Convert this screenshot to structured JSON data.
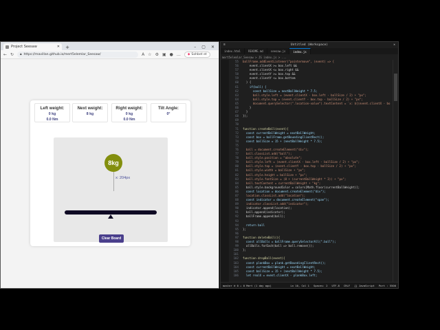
{
  "browser": {
    "tab_title": "Project Seesaw",
    "url": "https://mavillan.github.io/mert5elemlar_Seesaw/",
    "login_label": "Sohbet et"
  },
  "seesaw": {
    "left_weight_label": "Left weight:",
    "left_weight_value": "0 kg",
    "left_torque_value": "0.0 Nm",
    "next_weight_label": "Next weight:",
    "next_weight_value": "8 kg",
    "right_weight_label": "Right weight:",
    "right_weight_value": "0 kg",
    "right_torque_value": "0.0 Nm",
    "tilt_label": "Tilt Angle:",
    "tilt_value": "0°",
    "ball_label": "8kg",
    "ball_color": "#838f0e",
    "location_label": "x: 204px",
    "clear_button": "Clear Board"
  },
  "editor": {
    "title": "Untitled (Workspace)",
    "tabs": [
      "index.html",
      "README.md",
      "seesaw.js",
      "index.js"
    ],
    "active_tab": "index.js",
    "breadcrumb": "mert5elemlar_Seesaw > JS index.js > ...",
    "status_left": "master   ⊗ 0  ⚠ 0   Mert (1 day ago)",
    "status_right": [
      "Ln 10, Col 1",
      "Spaces: 2",
      "UTF-8",
      "CRLF",
      "{} JavaScript",
      "Port : 5500"
    ],
    "lines": [
      {
        "n": "55",
        "t": "ballFrame.addEventListener(\"pointermove\", (event) => {"
      },
      {
        "n": "56",
        "t": "    event.clientX >= box.left &&"
      },
      {
        "n": "57",
        "t": "    event.clientX <= box.right &&"
      },
      {
        "n": "58",
        "t": "    event.clientY >= box.top &&"
      },
      {
        "n": "59",
        "t": "    event.clientY <= box.bottom"
      },
      {
        "n": "60",
        "t": "  ) {"
      },
      {
        "n": "61",
        "t": "    if(ball) {"
      },
      {
        "n": "62",
        "t": "      const ballSize = nextBallWeight * 7.5;"
      },
      {
        "n": "63",
        "t": "      ball.style.left = (event.clientX - box.left - ballSize / 2) + \"px\";"
      },
      {
        "n": "64",
        "t": "      ball.style.top = (event.clientY - box.top - ballSize / 2) + \"px\";"
      },
      {
        "n": "65",
        "t": "      document.querySelector(\".location-value\").textContent = `x: ${(event.clientX - bo"
      },
      {
        "n": "66",
        "t": "    }"
      },
      {
        "n": "67",
        "t": "  }"
      },
      {
        "n": "68",
        "t": "});"
      },
      {
        "n": "69",
        "t": ""
      },
      {
        "n": "70",
        "t": ""
      },
      {
        "n": "71",
        "t": "function createBall(event){"
      },
      {
        "n": "72",
        "t": "  const currentBallWeight = nextBallWeight;"
      },
      {
        "n": "73",
        "t": "  const box = ballFrame.getBoundingClientRect();"
      },
      {
        "n": "74",
        "t": "  const ballSize = 15 + (nextBallWeight * 7.5);"
      },
      {
        "n": "75",
        "t": ""
      },
      {
        "n": "76",
        "t": "  ball = document.createElement(\"div\");"
      },
      {
        "n": "77",
        "t": "  ball.classList.add(\"ball\");"
      },
      {
        "n": "78",
        "t": "  ball.style.position = \"absolute\";"
      },
      {
        "n": "79",
        "t": "  ball.style.left = (event.clientX - box.left - ballSize / 2) + \"px\";"
      },
      {
        "n": "80",
        "t": "  ball.style.top = (event.clientY - box.top - ballSize / 2) + \"px\";"
      },
      {
        "n": "81",
        "t": "  ball.style.width = ballSize + \"px\";"
      },
      {
        "n": "82",
        "t": "  ball.style.height = ballSize + \"px\";"
      },
      {
        "n": "83",
        "t": "  ball.style.fontSize = (8 + (currentBallWeight * 3)) + \"px\";"
      },
      {
        "n": "84",
        "t": "  ball.textContent = currentBallWeight + \"kg\";"
      },
      {
        "n": "85",
        "t": "  ball.style.backgroundColor = colors[Math.floor(currentBallWeight)];"
      },
      {
        "n": "86",
        "t": "  const location = document.createElement(\"div\");"
      },
      {
        "n": "87",
        "t": "  location.classList.add(\"location\");"
      },
      {
        "n": "88",
        "t": "  const indicator = document.createElement(\"span\");"
      },
      {
        "n": "89",
        "t": "  indicator.classList.add(\"indicator\");"
      },
      {
        "n": "90",
        "t": "  indicator.append(location);"
      },
      {
        "n": "91",
        "t": "  ball.append(indicator);"
      },
      {
        "n": "92",
        "t": "  ballFrame.append(ball);"
      },
      {
        "n": "93",
        "t": ""
      },
      {
        "n": "94",
        "t": "  return ball"
      },
      {
        "n": "95",
        "t": "};"
      },
      {
        "n": "96",
        "t": ""
      },
      {
        "n": "97",
        "t": "function deleteBall(){"
      },
      {
        "n": "98",
        "t": "  const allBalls = ballFrame.querySelectorAll(\".ball\");"
      },
      {
        "n": "99",
        "t": "  allBalls.forEach(ball => ball.remove());"
      },
      {
        "n": "100",
        "t": "};"
      },
      {
        "n": "101",
        "t": ""
      },
      {
        "n": "102",
        "t": "function dropBall(event){"
      },
      {
        "n": "103",
        "t": "  const plankBox = plank.getBoundingClientRect();"
      },
      {
        "n": "104",
        "t": "  const currentBallWeight = nextBallWeight;"
      },
      {
        "n": "105",
        "t": "  const ballSize = 15 + (nextBallWeight * 7.5);"
      },
      {
        "n": "106",
        "t": "  let realX = event.clientX - plankBox.left;"
      }
    ]
  }
}
